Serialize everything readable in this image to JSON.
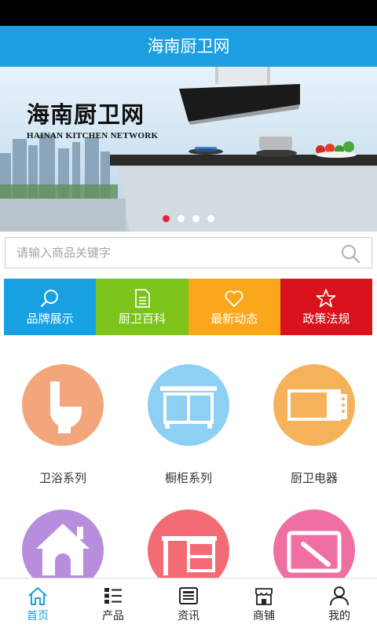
{
  "app": {
    "title": "海南厨卫网"
  },
  "banner": {
    "title": "海南厨卫网",
    "subtitle": "HAINAN KITCHEN NETWORK",
    "slide_count": 4,
    "active_slide": 1
  },
  "search": {
    "placeholder": "请输入商品关键字",
    "value": ""
  },
  "categories": [
    {
      "label": "品牌展示",
      "icon": "search-icon",
      "color": "#17a0e2"
    },
    {
      "label": "厨卫百科",
      "icon": "document-icon",
      "color": "#7cc41b"
    },
    {
      "label": "最新动态",
      "icon": "heart-icon",
      "color": "#fba71b"
    },
    {
      "label": "政策法规",
      "icon": "star-icon",
      "color": "#d9121c"
    }
  ],
  "grid": [
    {
      "label": "卫浴系列",
      "icon": "toilet-icon",
      "color": "#f3a57c"
    },
    {
      "label": "橱柜系列",
      "icon": "cabinet-icon",
      "color": "#8dd0f3"
    },
    {
      "label": "厨卫电器",
      "icon": "microwave-icon",
      "color": "#f6b25b"
    },
    {
      "label": "",
      "icon": "house-icon",
      "color": "#b98ddd"
    },
    {
      "label": "",
      "icon": "desk-icon",
      "color": "#f36c75"
    },
    {
      "label": "",
      "icon": "cutting-board-icon",
      "color": "#f06fa3"
    }
  ],
  "tabbar": [
    {
      "label": "首页",
      "icon": "home-icon",
      "active": true
    },
    {
      "label": "产品",
      "icon": "list-icon",
      "active": false
    },
    {
      "label": "资讯",
      "icon": "news-icon",
      "active": false
    },
    {
      "label": "商铺",
      "icon": "shop-icon",
      "active": false
    },
    {
      "label": "我的",
      "icon": "user-icon",
      "active": false
    }
  ],
  "colors": {
    "primary": "#1c9fe0",
    "indicator_active": "#e0262b"
  }
}
